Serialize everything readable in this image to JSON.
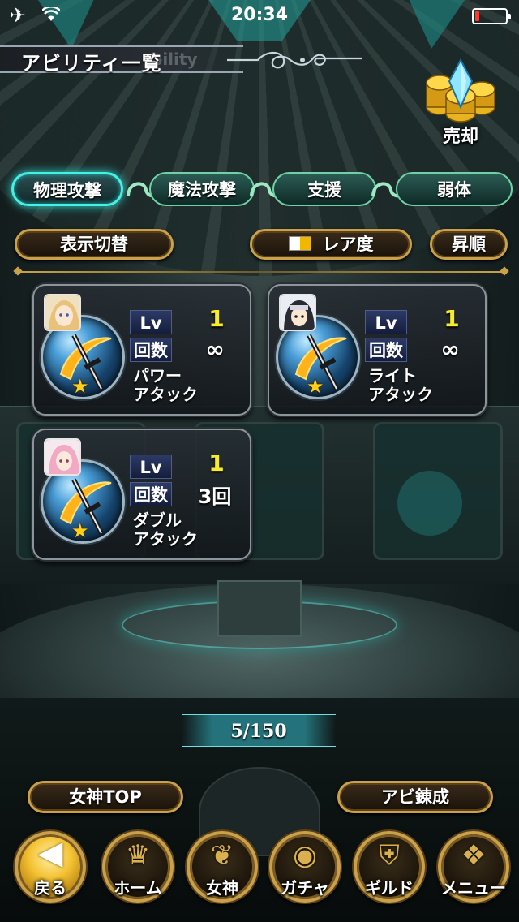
{
  "status_bar": {
    "time": "20:34",
    "battery_level": 0.15
  },
  "header": {
    "title": "アビリティ一覧",
    "ghost_text": "bility"
  },
  "sell_button": {
    "label": "売却"
  },
  "tabs": [
    {
      "label": "物理攻撃",
      "active": true
    },
    {
      "label": "魔法攻撃",
      "active": false
    },
    {
      "label": "支援",
      "active": false
    },
    {
      "label": "弱体",
      "active": false
    }
  ],
  "controls": {
    "display_toggle": "表示切替",
    "rarity_sort": "レア度",
    "order": "昇順"
  },
  "cards": [
    {
      "lv_label": "Lv",
      "lv": "1",
      "count_label": "回数",
      "count": "∞",
      "name_line1": "パワー",
      "name_line2": "アタック",
      "rarity_stars": "★"
    },
    {
      "lv_label": "Lv",
      "lv": "1",
      "count_label": "回数",
      "count": "∞",
      "name_line1": "ライト",
      "name_line2": "アタック",
      "rarity_stars": "★"
    },
    {
      "lv_label": "Lv",
      "lv": "1",
      "count_label": "回数",
      "count": "3回",
      "name_line1": "ダブル",
      "name_line2": "アタック",
      "rarity_stars": "★"
    }
  ],
  "page_counter": "5/150",
  "bottom_buttons": {
    "goddess_top": "女神TOP",
    "ability_refine": "アビ錬成"
  },
  "nav": [
    {
      "label": "戻る",
      "icon": "back-arrow-icon"
    },
    {
      "label": "ホーム",
      "icon": "home-icon"
    },
    {
      "label": "女神",
      "icon": "wing-icon"
    },
    {
      "label": "ガチャ",
      "icon": "gacha-icon"
    },
    {
      "label": "ギルド",
      "icon": "guild-icon"
    },
    {
      "label": "メニュー",
      "icon": "menu-icon"
    }
  ],
  "colors": {
    "accent_teal": "#47f0e4",
    "gold": "#c9a14a",
    "level_yellow": "#f7ec2a"
  }
}
